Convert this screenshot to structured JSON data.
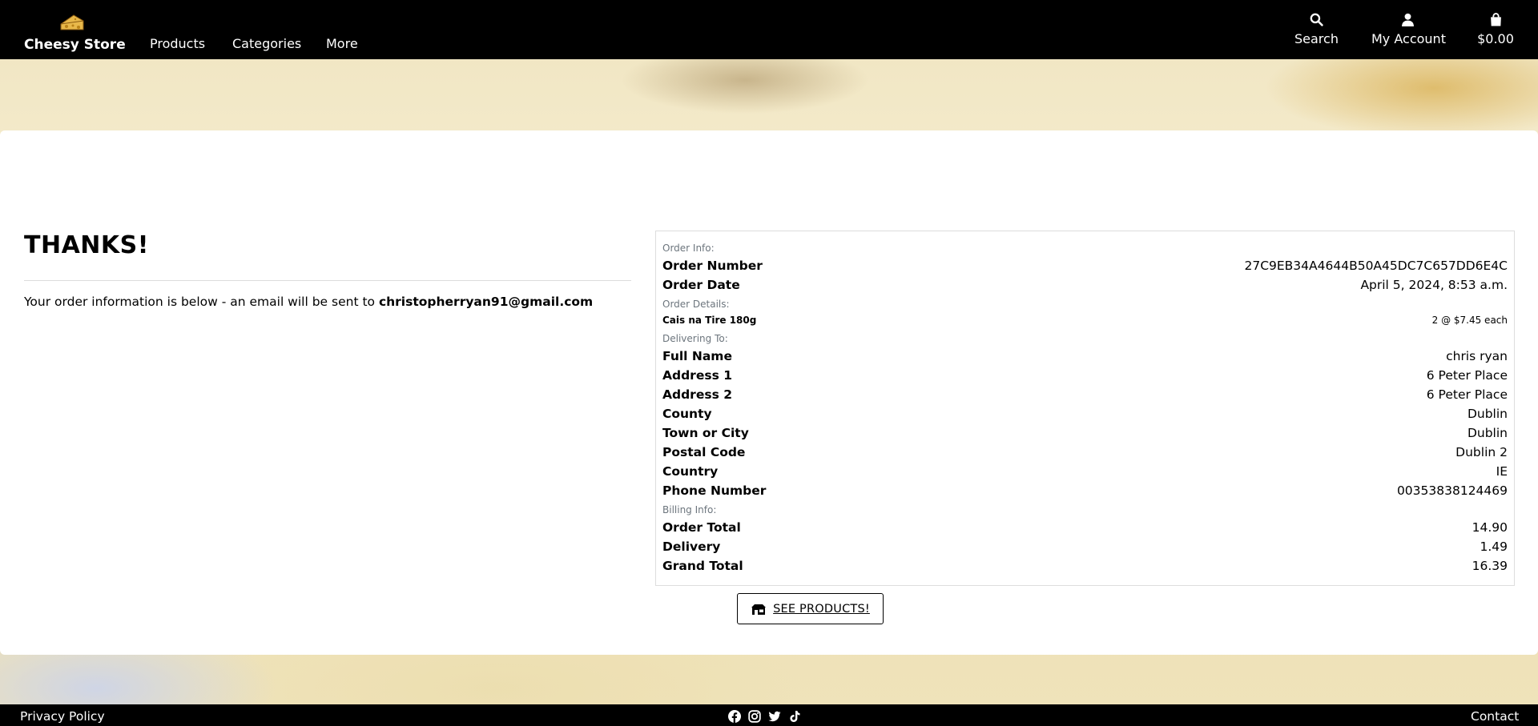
{
  "header": {
    "brand": "Cheesy Store",
    "nav": [
      "Products",
      "Categories",
      "More"
    ],
    "tools": {
      "search": "Search",
      "account": "My Account",
      "bag": "$0.00"
    }
  },
  "thanks": {
    "title": "THANKS!",
    "message": "Your order information is below - an email will be sent to ",
    "email": "christopherryan91@gmail.com"
  },
  "order": {
    "order_info_label": "Order Info:",
    "order_number_label": "Order Number",
    "order_number": "27C9EB34A4644B50A45DC7C657DD6E4C",
    "order_date_label": "Order Date",
    "order_date": "April 5, 2024, 8:53 a.m.",
    "order_details_label": "Order Details:",
    "item_name": "Cais na Tire 180g",
    "item_qty": "2 @ $7.45 each",
    "delivering_label": "Delivering To:",
    "delivery": [
      {
        "label": "Full Name",
        "value": "chris ryan"
      },
      {
        "label": "Address 1",
        "value": "6 Peter Place"
      },
      {
        "label": "Address 2",
        "value": "6 Peter Place"
      },
      {
        "label": "County",
        "value": "Dublin"
      },
      {
        "label": "Town or City",
        "value": "Dublin"
      },
      {
        "label": "Postal Code",
        "value": "Dublin 2"
      },
      {
        "label": "Country",
        "value": "IE"
      },
      {
        "label": "Phone Number",
        "value": "00353838124469"
      }
    ],
    "billing_label": "Billing Info:",
    "billing": [
      {
        "label": "Order Total",
        "value": "14.90"
      },
      {
        "label": "Delivery",
        "value": "1.49"
      },
      {
        "label": "Grand Total",
        "value": "16.39"
      }
    ]
  },
  "cta": {
    "label": "SEE PRODUCTS!"
  },
  "footer": {
    "privacy": "Privacy Policy",
    "contact": "Contact",
    "social_icons": [
      "facebook-icon",
      "instagram-icon",
      "twitter-icon",
      "tiktok-icon"
    ]
  }
}
